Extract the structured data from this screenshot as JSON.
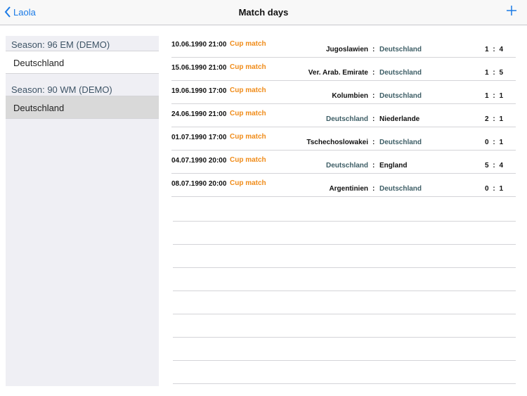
{
  "nav": {
    "back_label": "Laola",
    "title": "Match days"
  },
  "sidebar": {
    "sections": [
      {
        "header": "Season: 96 EM (DEMO)",
        "item": "Deutschland",
        "selected": false
      },
      {
        "header": "Season: 90 WM (DEMO)",
        "item": "Deutschland",
        "selected": true
      }
    ]
  },
  "matches": [
    {
      "datetime": "10.06.1990 21:00",
      "competition": "Cup match",
      "home": "Jugoslawien",
      "away": "Deutschland",
      "home_own": false,
      "score_home": "1",
      "score_away": "4"
    },
    {
      "datetime": "15.06.1990 21:00",
      "competition": "Cup match",
      "home": "Ver. Arab. Emirate",
      "away": "Deutschland",
      "home_own": false,
      "score_home": "1",
      "score_away": "5"
    },
    {
      "datetime": "19.06.1990 17:00",
      "competition": "Cup match",
      "home": "Kolumbien",
      "away": "Deutschland",
      "home_own": false,
      "score_home": "1",
      "score_away": "1"
    },
    {
      "datetime": "24.06.1990 21:00",
      "competition": "Cup match",
      "home": "Deutschland",
      "away": "Niederlande",
      "home_own": true,
      "score_home": "2",
      "score_away": "1"
    },
    {
      "datetime": "01.07.1990 17:00",
      "competition": "Cup match",
      "home": "Tschechoslowakei",
      "away": "Deutschland",
      "home_own": false,
      "score_home": "0",
      "score_away": "1"
    },
    {
      "datetime": "04.07.1990 20:00",
      "competition": "Cup match",
      "home": "Deutschland",
      "away": "England",
      "home_own": true,
      "score_home": "5",
      "score_away": "4"
    },
    {
      "datetime": "08.07.1990 20:00",
      "competition": "Cup match",
      "home": "Argentinien",
      "away": "Deutschland",
      "home_own": false,
      "score_home": "0",
      "score_away": "1"
    }
  ],
  "score_separator": ":",
  "team_separator": ":",
  "colors": {
    "accent": "#1a7ae6",
    "competition": "#f08c1a",
    "own_team": "#3e5e66",
    "selected_row": "#d9d9d9"
  }
}
